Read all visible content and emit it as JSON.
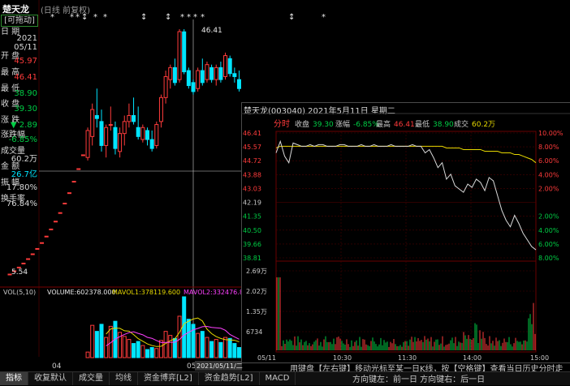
{
  "header": {
    "stock_name": "楚天龙",
    "mode": "(日线 前复权)"
  },
  "rail": {
    "draggable": "[可拖动]",
    "date_label": "日  期",
    "year": "2021",
    "date": "05/11",
    "open_label": "开  盘",
    "open": "45.97",
    "high_label": "最  高",
    "high": "46.41",
    "low_label": "最  低",
    "low": "38.90",
    "close_label": "收  盘",
    "close": "39.30",
    "change_label": "涨  跌",
    "change": "▼ 2.89",
    "pct_label": "涨跌幅",
    "pct": "-6.85%",
    "vol_label": "成交量",
    "vol": "60.2万",
    "amount_label": "金  额",
    "amount": "26.7亿",
    "amp_label": "振  幅",
    "amp": "17.80%",
    "turnover_label": "换手率",
    "turnover": "76.84%"
  },
  "candle_annotations": {
    "high_label": "46.41",
    "low_label": "5.54"
  },
  "volume_header": {
    "name": "VOL(5,10)",
    "volume": "VOLUME:602378.000",
    "mavol1": "MAVOL1:378119.600",
    "mavol2": "MAVOL2:332476.800"
  },
  "candle_date_labels": [
    "04",
    "05",
    "2021/05/11/二"
  ],
  "popup": {
    "title": "楚天龙(003040)  2021年5月11日 星期二",
    "bar": {
      "mode": "分时",
      "close_label": "收盘",
      "close": "39.30",
      "pct_label": "涨幅",
      "pct": "-6.85%",
      "high_label": "最高",
      "high": "46.41",
      "low_label": "最低",
      "low": "38.90",
      "vol_label": "成交",
      "vol": "60.2万"
    },
    "price_ticks": [
      "46.41",
      "45.57",
      "44.72",
      "43.88",
      "43.03",
      "42.19",
      "41.35",
      "40.50",
      "39.66",
      "38.81"
    ],
    "pct_ticks": [
      "10.00%",
      "8.00%",
      "6.00%",
      "4.00%",
      "2.00%",
      "",
      "2.00%",
      "4.00%",
      "6.00%",
      "8.00%"
    ],
    "vol_ticks": [
      "2.69万",
      "2.02万",
      "1.35万",
      "6734"
    ],
    "time_ticks": [
      "05/11",
      "10:30",
      "11:30",
      "14:00",
      "15:00"
    ],
    "help_line1": "用键盘【左右键】移动光标至某一日K线，按【空格键】查看当日历史分时走势",
    "help_line2": "方向键左：前一日    方向键右：后一日"
  },
  "tabs": [
    "指标",
    "收复默认",
    "成交量",
    "均线",
    "资金博弈[L2]",
    "资金趋势[L2]",
    "MACD"
  ],
  "colors": {
    "up": "#ff3b3b",
    "down": "#00e5ff",
    "price_line": "#d9d9d9",
    "avg_line": "#e6d800",
    "green": "#00cc44"
  },
  "chart_data": [
    {
      "type": "candlestick",
      "title": "楚天龙 日线 前复权",
      "y_annotated_high": 46.41,
      "y_annotated_low": 5.54,
      "x_labels_visible": [
        "04",
        "05"
      ],
      "selected_date": "2021/05/11",
      "candles": [
        {
          "o": 5.54,
          "h": 5.54,
          "l": 5.54,
          "c": 5.54
        },
        {
          "o": 6.09,
          "h": 6.09,
          "l": 6.09,
          "c": 6.09
        },
        {
          "o": 6.7,
          "h": 6.7,
          "l": 6.7,
          "c": 6.7
        },
        {
          "o": 7.37,
          "h": 7.37,
          "l": 7.37,
          "c": 7.37
        },
        {
          "o": 8.11,
          "h": 8.11,
          "l": 8.11,
          "c": 8.11
        },
        {
          "o": 8.92,
          "h": 8.92,
          "l": 8.92,
          "c": 8.92
        },
        {
          "o": 9.81,
          "h": 9.81,
          "l": 9.81,
          "c": 9.81
        },
        {
          "o": 10.79,
          "h": 10.79,
          "l": 10.79,
          "c": 10.79
        },
        {
          "o": 11.87,
          "h": 11.87,
          "l": 11.87,
          "c": 11.87
        },
        {
          "o": 13.06,
          "h": 13.06,
          "l": 13.06,
          "c": 13.06
        },
        {
          "o": 14.37,
          "h": 14.37,
          "l": 14.37,
          "c": 14.37
        },
        {
          "o": 15.8,
          "h": 15.8,
          "l": 15.8,
          "c": 15.8
        },
        {
          "o": 17.38,
          "h": 17.38,
          "l": 17.38,
          "c": 17.38
        },
        {
          "o": 19.12,
          "h": 19.12,
          "l": 19.12,
          "c": 19.12
        },
        {
          "o": 21.03,
          "h": 21.03,
          "l": 21.03,
          "c": 21.03
        },
        {
          "o": 23.13,
          "h": 23.13,
          "l": 23.13,
          "c": 23.13
        },
        {
          "o": 25.44,
          "h": 25.44,
          "l": 25.44,
          "c": 25.44
        },
        {
          "o": 25.0,
          "h": 30.0,
          "l": 24.5,
          "c": 29.5
        },
        {
          "o": 28.5,
          "h": 34.0,
          "l": 27.0,
          "c": 33.0
        },
        {
          "o": 32.0,
          "h": 36.5,
          "l": 30.0,
          "c": 31.5
        },
        {
          "o": 31.0,
          "h": 33.0,
          "l": 26.0,
          "c": 27.0
        },
        {
          "o": 27.0,
          "h": 30.5,
          "l": 25.0,
          "c": 30.0
        },
        {
          "o": 30.5,
          "h": 33.5,
          "l": 29.5,
          "c": 30.5
        },
        {
          "o": 30.0,
          "h": 31.0,
          "l": 25.5,
          "c": 26.5
        },
        {
          "o": 26.0,
          "h": 30.0,
          "l": 25.0,
          "c": 29.0
        },
        {
          "o": 29.0,
          "h": 32.0,
          "l": 27.0,
          "c": 31.0
        },
        {
          "o": 31.0,
          "h": 34.0,
          "l": 30.0,
          "c": 32.0
        },
        {
          "o": 32.0,
          "h": 35.0,
          "l": 30.5,
          "c": 31.0
        },
        {
          "o": 30.0,
          "h": 33.5,
          "l": 28.0,
          "c": 28.5
        },
        {
          "o": 28.0,
          "h": 30.5,
          "l": 27.5,
          "c": 30.0
        },
        {
          "o": 29.5,
          "h": 30.0,
          "l": 27.0,
          "c": 28.0
        },
        {
          "o": 28.0,
          "h": 29.5,
          "l": 26.0,
          "c": 26.5
        },
        {
          "o": 27.0,
          "h": 31.0,
          "l": 26.5,
          "c": 30.5
        },
        {
          "o": 31.0,
          "h": 35.5,
          "l": 30.0,
          "c": 35.0
        },
        {
          "o": 35.0,
          "h": 39.5,
          "l": 34.0,
          "c": 38.5
        },
        {
          "o": 38.0,
          "h": 40.5,
          "l": 36.5,
          "c": 40.0
        },
        {
          "o": 40.0,
          "h": 41.5,
          "l": 37.0,
          "c": 37.5
        },
        {
          "o": 38.0,
          "h": 46.41,
          "l": 37.5,
          "c": 46.0
        },
        {
          "o": 45.97,
          "h": 46.41,
          "l": 38.9,
          "c": 39.3
        },
        {
          "o": 39.5,
          "h": 40.0,
          "l": 36.5,
          "c": 37.0
        },
        {
          "o": 37.5,
          "h": 38.0,
          "l": 35.5,
          "c": 36.0
        },
        {
          "o": 36.5,
          "h": 40.0,
          "l": 36.0,
          "c": 39.5
        },
        {
          "o": 39.5,
          "h": 41.5,
          "l": 37.0,
          "c": 37.5
        },
        {
          "o": 38.0,
          "h": 41.0,
          "l": 37.5,
          "c": 40.5
        },
        {
          "o": 40.0,
          "h": 40.5,
          "l": 37.5,
          "c": 38.0
        },
        {
          "o": 38.0,
          "h": 40.5,
          "l": 37.0,
          "c": 40.0
        },
        {
          "o": 40.0,
          "h": 41.0,
          "l": 37.5,
          "c": 38.0
        },
        {
          "o": 38.5,
          "h": 42.5,
          "l": 38.0,
          "c": 42.0
        },
        {
          "o": 41.5,
          "h": 42.0,
          "l": 38.5,
          "c": 39.0
        },
        {
          "o": 39.0,
          "h": 40.0,
          "l": 37.5,
          "c": 38.5
        },
        {
          "o": 38.0,
          "h": 39.5,
          "l": 36.0,
          "c": 36.5
        }
      ]
    },
    {
      "type": "bar",
      "title": "VOL(5,10)",
      "values": [
        0,
        0,
        0,
        0,
        0,
        0,
        0,
        0,
        0,
        0,
        0,
        0,
        0,
        0,
        0,
        0,
        0,
        55000,
        320000,
        260000,
        330000,
        200000,
        310000,
        360000,
        250000,
        210000,
        180000,
        140000,
        160000,
        120000,
        80000,
        100000,
        90000,
        170000,
        260000,
        220000,
        190000,
        410000,
        602378,
        380000,
        330000,
        240000,
        260000,
        200000,
        160000,
        180000,
        150000,
        200000,
        190000,
        140000,
        100000
      ],
      "mavol1": 378119.6,
      "mavol2": 332476.8
    },
    {
      "type": "line",
      "title": "分时",
      "ylim": [
        38.81,
        46.41
      ],
      "prev_close": 42.19,
      "x_ticks": [
        "05/11",
        "10:30",
        "11:30",
        "14:00",
        "15:00"
      ],
      "price": [
        45.2,
        45.9,
        45.0,
        44.6,
        45.8,
        45.7,
        45.6,
        45.6,
        45.7,
        45.6,
        45.7,
        45.7,
        45.6,
        45.6,
        45.6,
        45.7,
        45.7,
        45.6,
        45.6,
        45.6,
        45.7,
        45.6,
        45.6,
        45.7,
        45.6,
        45.6,
        45.6,
        45.7,
        45.6,
        45.6,
        45.6,
        45.6,
        45.7,
        45.6,
        45.6,
        45.2,
        45.4,
        44.9,
        44.3,
        44.6,
        43.6,
        43.9,
        43.2,
        43.0,
        42.8,
        43.3,
        43.1,
        43.6,
        43.4,
        42.9,
        43.7,
        43.5,
        42.6,
        41.7,
        41.1,
        40.7,
        41.4,
        40.9,
        40.3,
        39.9,
        39.5,
        39.3
      ],
      "average": [
        45.5,
        45.6,
        45.6,
        45.6,
        45.6,
        45.6,
        45.6,
        45.6,
        45.6,
        45.6,
        45.6,
        45.6,
        45.6,
        45.6,
        45.6,
        45.6,
        45.6,
        45.6,
        45.6,
        45.6,
        45.6,
        45.6,
        45.6,
        45.6,
        45.6,
        45.6,
        45.6,
        45.6,
        45.6,
        45.6,
        45.6,
        45.6,
        45.6,
        45.6,
        45.6,
        45.6,
        45.6,
        45.6,
        45.6,
        45.6,
        45.5,
        45.5,
        45.5,
        45.5,
        45.4,
        45.4,
        45.4,
        45.4,
        45.4,
        45.3,
        45.3,
        45.3,
        45.3,
        45.2,
        45.2,
        45.2,
        45.1,
        45.1,
        45.0,
        44.9,
        44.8,
        44.6
      ],
      "volume_scale_max": 26900
    }
  ]
}
